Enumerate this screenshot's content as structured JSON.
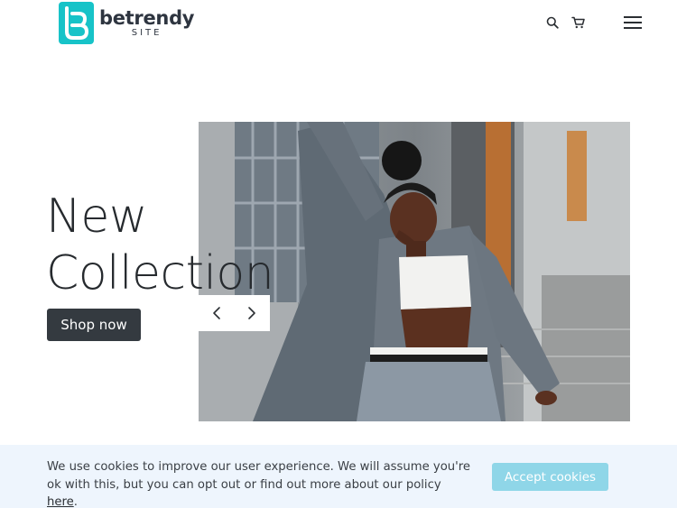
{
  "header": {
    "logo_word": "betrendy",
    "logo_sub": "SITE",
    "icons": [
      "search-icon",
      "cart-icon",
      "hamburger-menu-icon"
    ]
  },
  "hero": {
    "title_line1": "New",
    "title_line2": "Collection",
    "cta_label": "Shop now",
    "slider_icons": [
      "chevron-left-icon",
      "chevron-right-icon"
    ]
  },
  "cookie": {
    "text_before_link": "We use cookies to improve our user experience. We will assume you're ok with this, but you can opt out or find out more about our policy ",
    "link_label": "here",
    "text_after_link": ".",
    "accept_label": "Accept cookies"
  },
  "colors": {
    "brand_teal": "#17c3c8",
    "button_dark": "#343a40",
    "cookie_bg": "#eef5fd",
    "accept_button": "#8fd6e8"
  }
}
